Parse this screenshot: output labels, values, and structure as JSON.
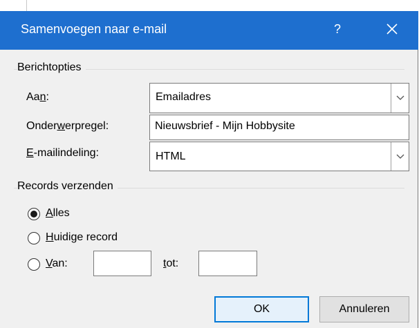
{
  "window": {
    "title": "Samenvoegen naar e-mail",
    "help_label": "?",
    "titlebar_color": "#1e6fcf"
  },
  "message_options": {
    "group_label": "Berichtopties",
    "to": {
      "label_pre": "Aa",
      "label_mnemonic": "n",
      "label_post": ":",
      "value": "Emailadres"
    },
    "subject": {
      "label_pre": "Onder",
      "label_mnemonic": "w",
      "label_post": "erpregel:",
      "value": "Nieuwsbrief - Mijn Hobbysite"
    },
    "format": {
      "label_mnemonic": "E",
      "label_post": "-mailindeling:",
      "value": "HTML"
    }
  },
  "send_records": {
    "group_label": "Records verzenden",
    "options": [
      {
        "mnemonic": "A",
        "rest": "lles",
        "selected": true
      },
      {
        "mnemonic": "H",
        "rest": "uidige record",
        "selected": false
      },
      {
        "mnemonic": "V",
        "rest": "an:",
        "selected": false
      }
    ],
    "to_label_mnemonic": "t",
    "to_label_rest": "ot:",
    "from_value": "",
    "to_value": ""
  },
  "buttons": {
    "ok": "OK",
    "cancel": "Annuleren"
  }
}
